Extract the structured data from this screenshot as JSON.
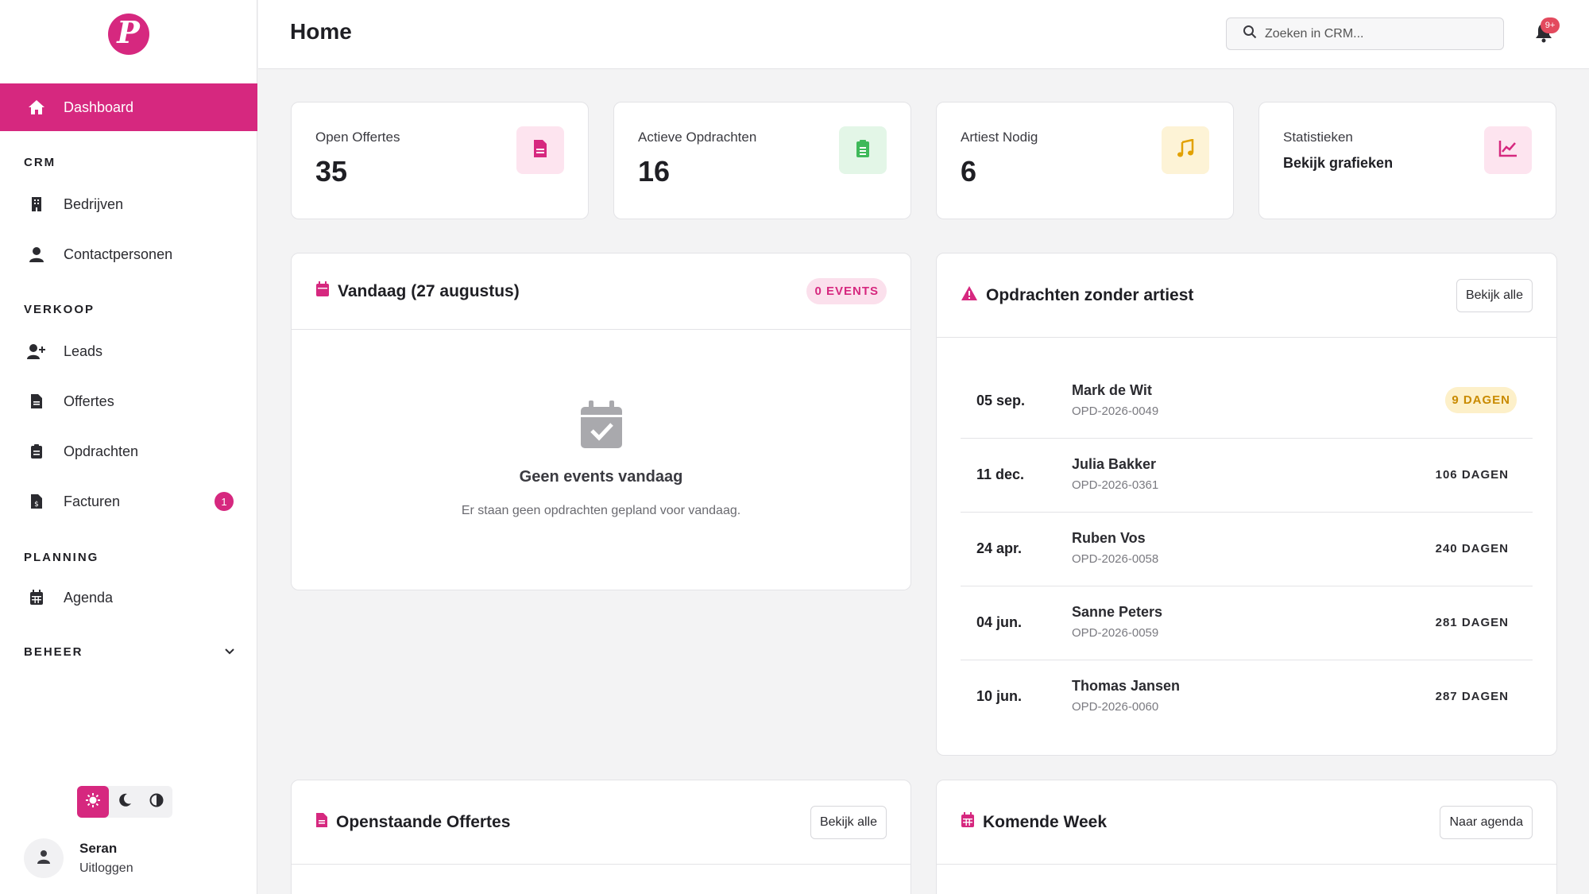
{
  "sidebar": {
    "logo_letter": "P",
    "active_item": "Dashboard",
    "sections": [
      "CRM",
      "VERKOOP",
      "PLANNING"
    ],
    "crm_items": [
      "Bedrijven",
      "Contactpersonen"
    ],
    "verkoop_items": [
      "Leads",
      "Offertes",
      "Opdrachten",
      "Facturen"
    ],
    "facturen_badge": "1",
    "planning_items": [
      "Agenda"
    ],
    "beheer": "BEHEER",
    "user": {
      "name": "Seran",
      "logout": "Uitloggen"
    }
  },
  "header": {
    "title": "Home",
    "search_placeholder": "Zoeken in CRM...",
    "notifications_badge": "9+"
  },
  "stats": [
    {
      "label": "Open Offertes",
      "value": "35"
    },
    {
      "label": "Actieve Opdrachten",
      "value": "16"
    },
    {
      "label": "Artiest Nodig",
      "value": "6"
    },
    {
      "label": "Statistieken",
      "value": "Bekijk grafieken"
    }
  ],
  "today": {
    "title": "Vandaag (27 augustus)",
    "badge": "0 EVENTS",
    "empty_title": "Geen events vandaag",
    "empty_sub": "Er staan geen opdrachten gepland voor vandaag."
  },
  "no_artist": {
    "title": "Opdrachten zonder artiest",
    "button": "Bekijk alle",
    "rows": [
      {
        "date": "05 sep.",
        "name": "Mark de Wit",
        "code": "OPD-2026-0049",
        "days": "9 DAGEN"
      },
      {
        "date": "11 dec.",
        "name": "Julia Bakker",
        "code": "OPD-2026-0361",
        "days": "106 DAGEN"
      },
      {
        "date": "24 apr.",
        "name": "Ruben Vos",
        "code": "OPD-2026-0058",
        "days": "240 DAGEN"
      },
      {
        "date": "04 jun.",
        "name": "Sanne Peters",
        "code": "OPD-2026-0059",
        "days": "281 DAGEN"
      },
      {
        "date": "10 jun.",
        "name": "Thomas Jansen",
        "code": "OPD-2026-0060",
        "days": "287 DAGEN"
      }
    ]
  },
  "open_quotes": {
    "title": "Openstaande Offertes",
    "button": "Bekijk alle"
  },
  "coming_week": {
    "title": "Komende Week",
    "button": "Naar agenda"
  },
  "colors": {
    "accent": "#d6287f",
    "success": "#3fb95a",
    "warning": "#e2a100",
    "badge_red": "#e34a5e"
  }
}
